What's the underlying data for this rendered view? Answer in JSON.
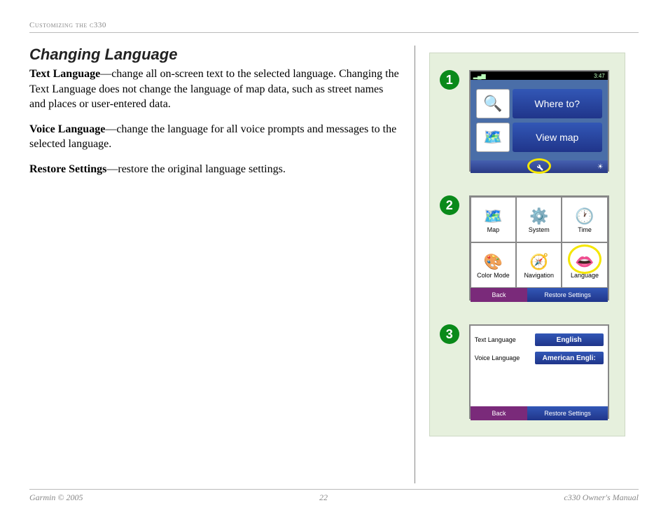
{
  "header": "Customizing the c330",
  "title": "Changing Language",
  "paragraphs": {
    "p1_lead": "Text Language",
    "p1_body": "—change all on-screen text to the selected language. Changing the Text Language does not change the language of map data, such as street names and places or user-entered data.",
    "p2_lead": "Voice Language",
    "p2_body": "—change the language for all voice prompts and messages to the selected language.",
    "p3_lead": "Restore Settings",
    "p3_body": "—restore the original language settings."
  },
  "steps": [
    "1",
    "2",
    "3"
  ],
  "screen1": {
    "time": "3:47",
    "where_to": "Where to?",
    "view_map": "View map",
    "brightness_icon": "☀"
  },
  "screen2": {
    "items": [
      "Map",
      "System",
      "Time",
      "Color Mode",
      "Navigation",
      "Language"
    ],
    "back": "Back",
    "restore": "Restore Settings"
  },
  "screen3": {
    "text_label": "Text Language",
    "voice_label": "Voice Language",
    "text_value": "English",
    "voice_value": "American Engli:",
    "back": "Back",
    "restore": "Restore Settings"
  },
  "footer": {
    "left": "Garmin © 2005",
    "center": "22",
    "right": "c330 Owner's Manual"
  }
}
